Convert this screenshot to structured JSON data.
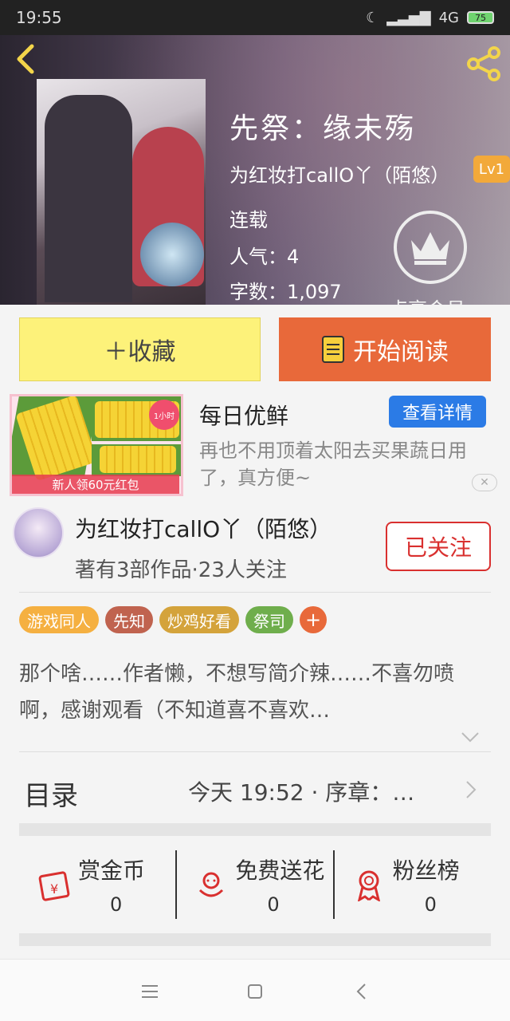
{
  "statusbar": {
    "time": "19:55",
    "network": "4G",
    "battery": "75"
  },
  "book": {
    "title": "先祭：缘未殇",
    "author": "为红妆打callO丫（陌悠）",
    "level": "Lv1",
    "status": "连载",
    "popularity": "人气：4",
    "word_count": "字数：1,097",
    "vip_label": "点亮会员"
  },
  "actions": {
    "favorite": "＋收藏",
    "read": "开始阅读"
  },
  "ad": {
    "title": "每日优鲜",
    "description": "再也不用顶着太阳去买果蔬日用了，真方便~",
    "button": "查看详情",
    "image_badge": "新人领60元红包",
    "image_corner": "1小时",
    "close": "✕"
  },
  "author_card": {
    "name": "为红妆打callO丫（陌悠）",
    "meta": "著有3部作品·23人关注",
    "follow": "已关注"
  },
  "tags": [
    {
      "label": "游戏同人",
      "color": "#f5b041"
    },
    {
      "label": "先知",
      "color": "#c0634f"
    },
    {
      "label": "炒鸡好看",
      "color": "#d4a33b"
    },
    {
      "label": "祭司",
      "color": "#6fae4c"
    }
  ],
  "tag_add": "+",
  "description": "那个啥……作者懒，不想写简介辣……不喜勿喷啊，感谢观看（不知道喜不喜欢…",
  "toc": {
    "label": "目录",
    "latest": "今天 19:52 · 序章：…"
  },
  "stats": [
    {
      "label": "赏金币",
      "value": "0",
      "icon": "red-envelope-icon"
    },
    {
      "label": "免费送花",
      "value": "0",
      "icon": "flower-icon"
    },
    {
      "label": "粉丝榜",
      "value": "0",
      "icon": "medal-icon"
    }
  ]
}
